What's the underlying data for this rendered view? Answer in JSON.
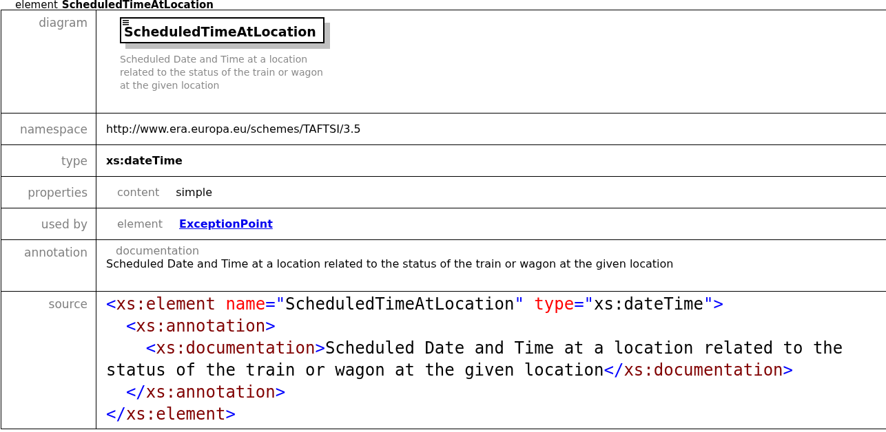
{
  "heading": {
    "kind_label": "element",
    "name": "ScheduledTimeAtLocation"
  },
  "diagram": {
    "label": "diagram",
    "node_name": "ScheduledTimeAtLocation",
    "description": "Scheduled Date and Time at a location related to the status of the train or wagon at the given location"
  },
  "namespace": {
    "label": "namespace",
    "value": "http://www.era.europa.eu/schemes/TAFTSI/3.5"
  },
  "type": {
    "label": "type",
    "value": "xs:dateTime"
  },
  "properties": {
    "label": "properties",
    "key": "content",
    "value": "simple"
  },
  "used_by": {
    "label": "used by",
    "key": "element",
    "link": "ExceptionPoint"
  },
  "annotation": {
    "label": "annotation",
    "key": "documentation",
    "text": "Scheduled Date and Time at a location related to the status of the train or wagon at the given location"
  },
  "source": {
    "label": "source",
    "lines": [
      [
        {
          "kind": "punct",
          "text": "<"
        },
        {
          "kind": "tag",
          "text": "xs:element"
        },
        {
          "kind": "attr",
          "text": " name"
        },
        {
          "kind": "punct",
          "text": "=\""
        },
        {
          "kind": "text",
          "text": "ScheduledTimeAtLocation"
        },
        {
          "kind": "punct",
          "text": "\""
        },
        {
          "kind": "attr",
          "text": " type"
        },
        {
          "kind": "punct",
          "text": "=\""
        },
        {
          "kind": "text",
          "text": "xs:dateTime"
        },
        {
          "kind": "punct",
          "text": "\">"
        }
      ],
      [
        {
          "kind": "punct",
          "text": "  <"
        },
        {
          "kind": "tag",
          "text": "xs:annotation"
        },
        {
          "kind": "punct",
          "text": ">"
        }
      ],
      [
        {
          "kind": "punct",
          "text": "    <"
        },
        {
          "kind": "tag",
          "text": "xs:documentation"
        },
        {
          "kind": "punct",
          "text": ">"
        },
        {
          "kind": "text",
          "text": "Scheduled Date and Time at a location related to the status of the train or wagon at the given location"
        },
        {
          "kind": "punct",
          "text": "</"
        },
        {
          "kind": "tag",
          "text": "xs:documentation"
        },
        {
          "kind": "punct",
          "text": ">"
        }
      ],
      [
        {
          "kind": "punct",
          "text": "  </"
        },
        {
          "kind": "tag",
          "text": "xs:annotation"
        },
        {
          "kind": "punct",
          "text": ">"
        }
      ],
      [
        {
          "kind": "punct",
          "text": "</"
        },
        {
          "kind": "tag",
          "text": "xs:element"
        },
        {
          "kind": "punct",
          "text": ">"
        }
      ]
    ]
  }
}
